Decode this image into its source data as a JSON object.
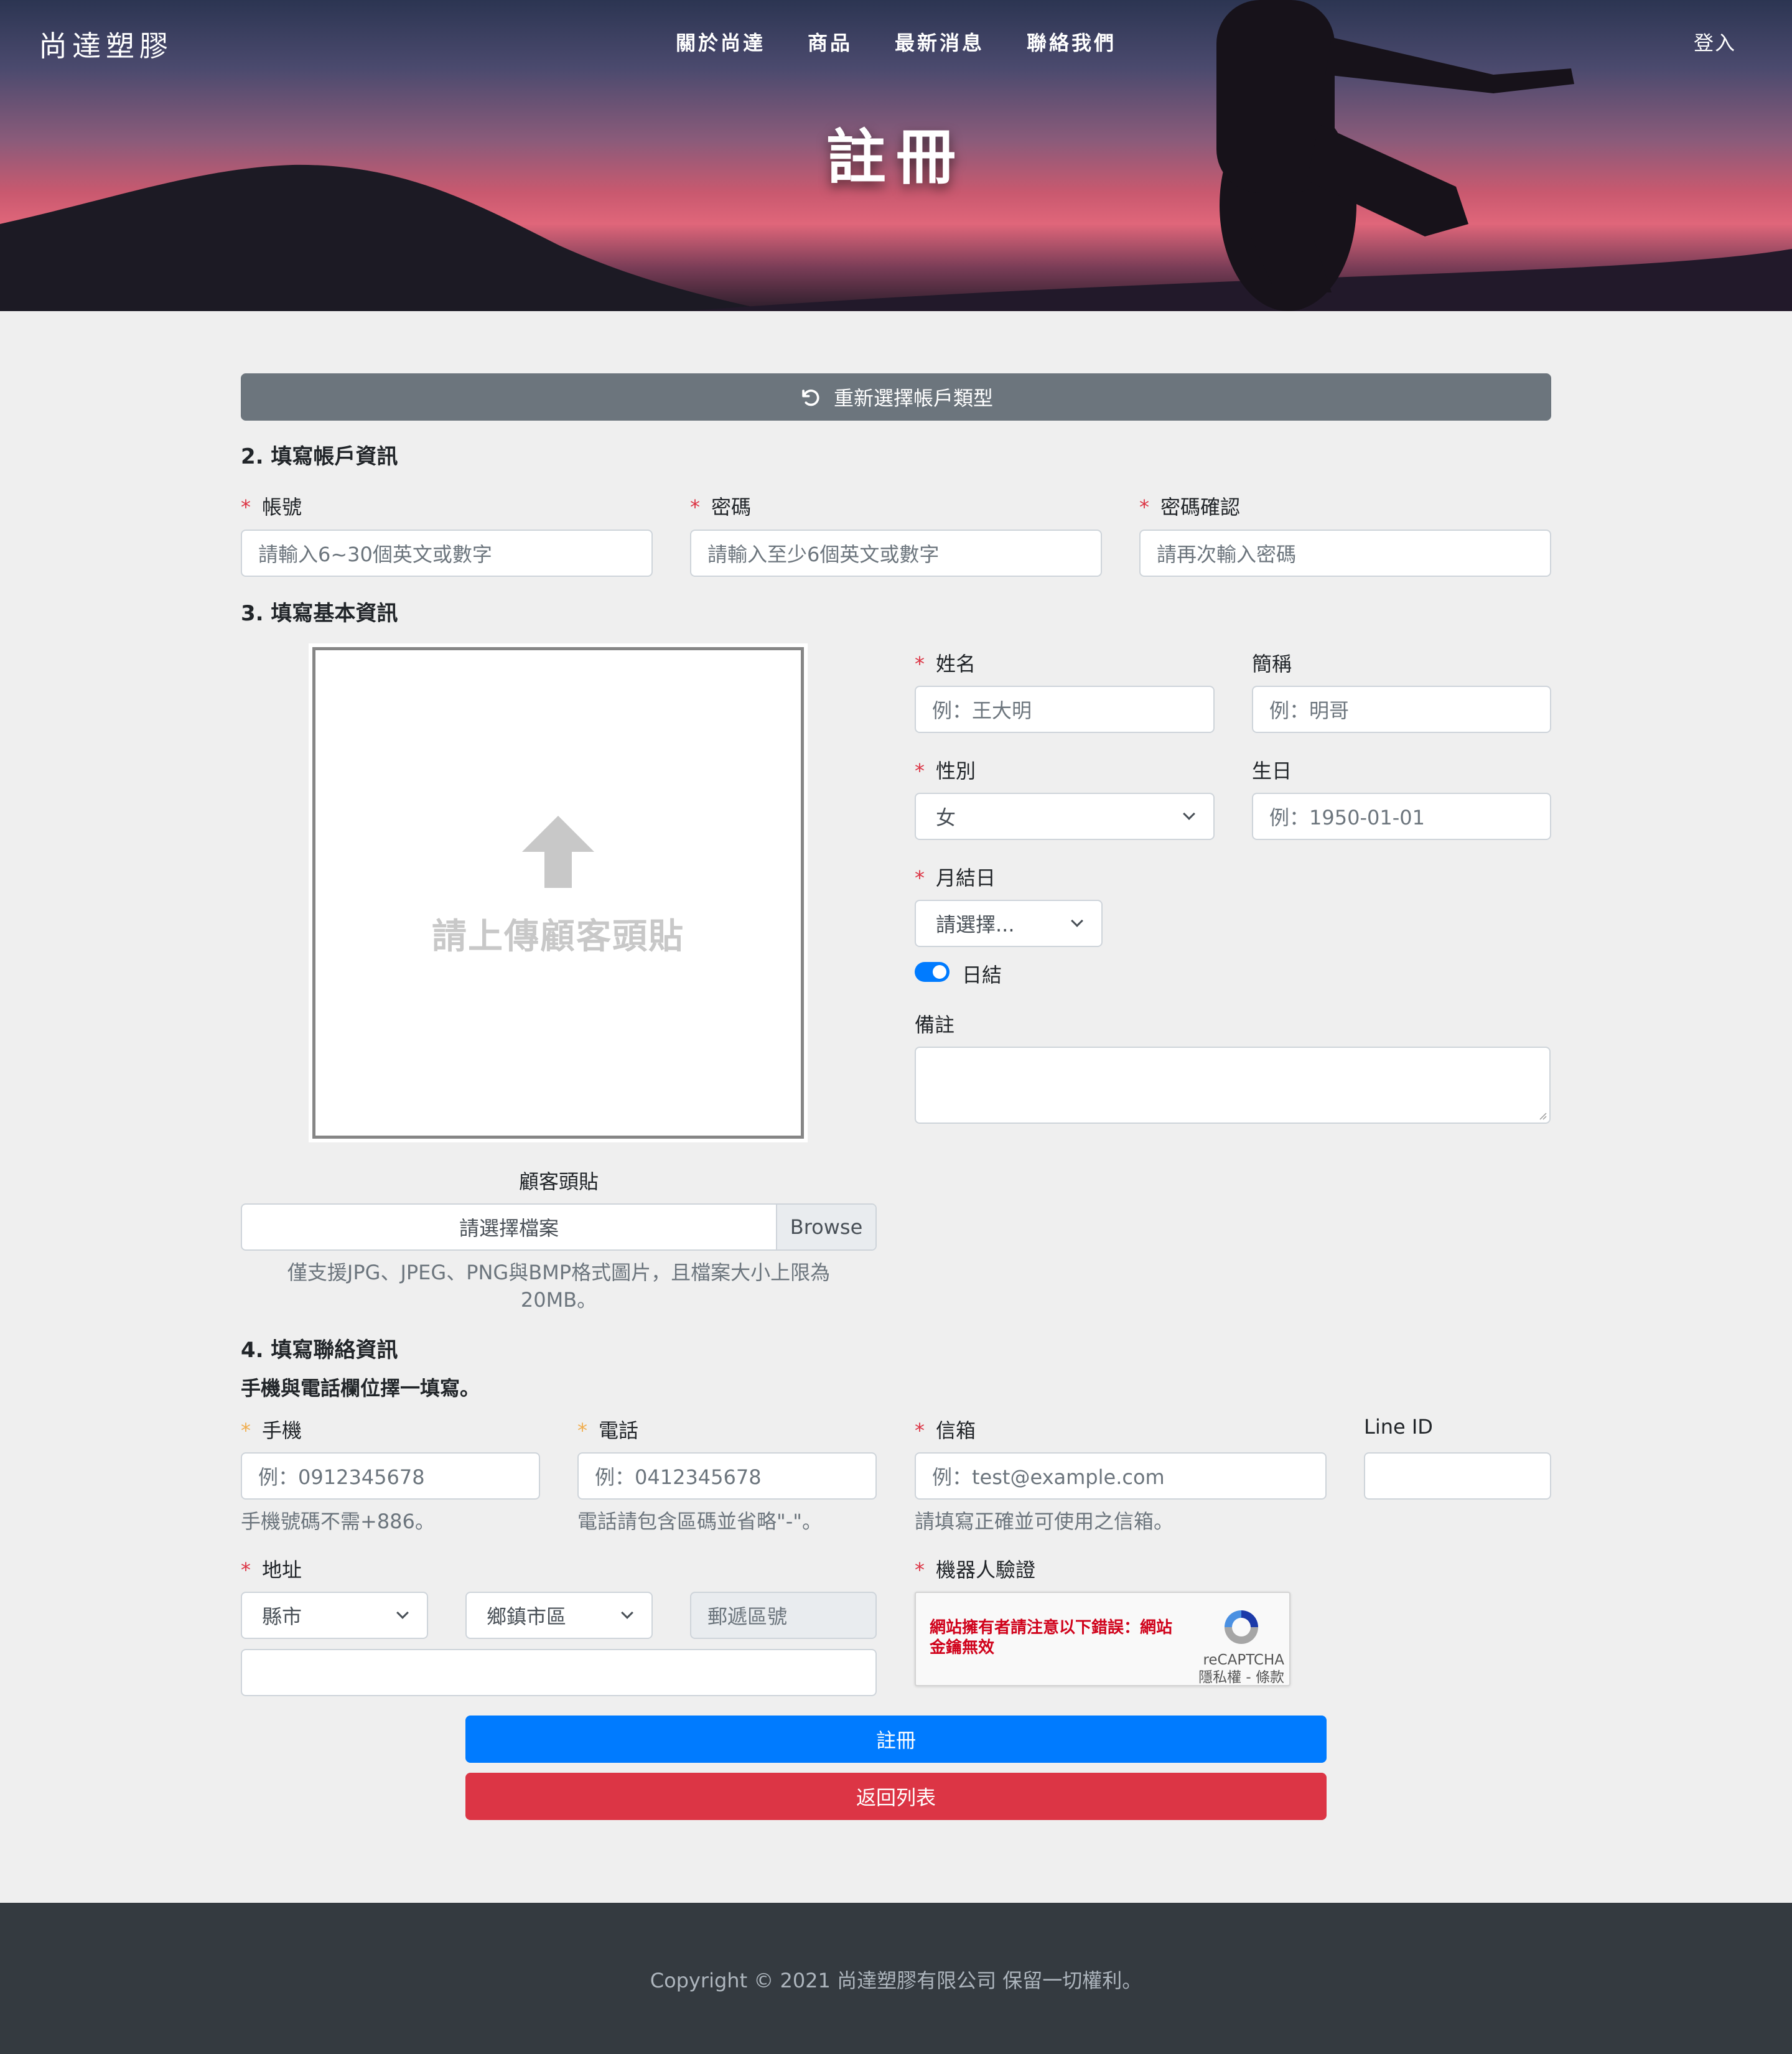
{
  "header": {
    "brand": "尚達塑膠",
    "nav": [
      "關於尚達",
      "商品",
      "最新消息",
      "聯絡我們"
    ],
    "login": "登入",
    "title": "註冊"
  },
  "reset_button": "重新選擇帳戶類型",
  "account": {
    "heading": "2. 填寫帳戶資訊",
    "username_label": "帳號",
    "username_placeholder": "請輸入6~30個英文或數字",
    "password_label": "密碼",
    "password_placeholder": "請輸入至少6個英文或數字",
    "confirm_label": "密碼確認",
    "confirm_placeholder": "請再次輸入密碼"
  },
  "basic": {
    "heading": "3. 填寫基本資訊",
    "upload_text": "請上傳顧客頭貼",
    "avatar_label": "顧客頭貼",
    "file_placeholder": "請選擇檔案",
    "browse": "Browse",
    "file_help_1": "僅支援JPG、JPEG、PNG與BMP格式圖片，且檔案大小上限為",
    "file_help_2": "20MB。",
    "name_label": "姓名",
    "name_placeholder": "例：王大明",
    "nickname_label": "簡稱",
    "nickname_placeholder": "例：明哥",
    "gender_label": "性別",
    "gender_value": "女",
    "birthday_label": "生日",
    "birthday_placeholder": "例：1950-01-01",
    "settlement_label": "月結日",
    "settlement_value": "請選擇...",
    "daily_label": "日結",
    "daily_on": true,
    "note_label": "備註"
  },
  "contact": {
    "heading": "4. 填寫聯絡資訊",
    "subnote": "手機與電話欄位擇一填寫。",
    "mobile_label": "手機",
    "mobile_placeholder": "例：0912345678",
    "mobile_help": "手機號碼不需+886。",
    "phone_label": "電話",
    "phone_placeholder": "例：0412345678",
    "phone_help": "電話請包含區碼並省略\"-\"。",
    "email_label": "信箱",
    "email_placeholder": "例：test@example.com",
    "email_help": "請填寫正確並可使用之信箱。",
    "line_label": "Line ID",
    "address_label": "地址",
    "city_value": "縣市",
    "district_value": "鄉鎮市區",
    "zip_placeholder": "郵遞區號",
    "captcha_label": "機器人驗證",
    "captcha_error": "網站擁有者請注意以下錯誤：網站金鑰無效",
    "captcha_brand": "reCAPTCHA",
    "captcha_links": "隱私權 - 條款"
  },
  "submit": "註冊",
  "back": "返回列表",
  "footer": "Copyright © 2021 尚達塑膠有限公司 保留一切權利。",
  "colors": {
    "primary": "#007bff",
    "danger": "#dc3545",
    "secondary": "#6c757d",
    "footer_bg": "#343a40",
    "required": "#dc3545",
    "either_required": "#f0ad4e"
  }
}
